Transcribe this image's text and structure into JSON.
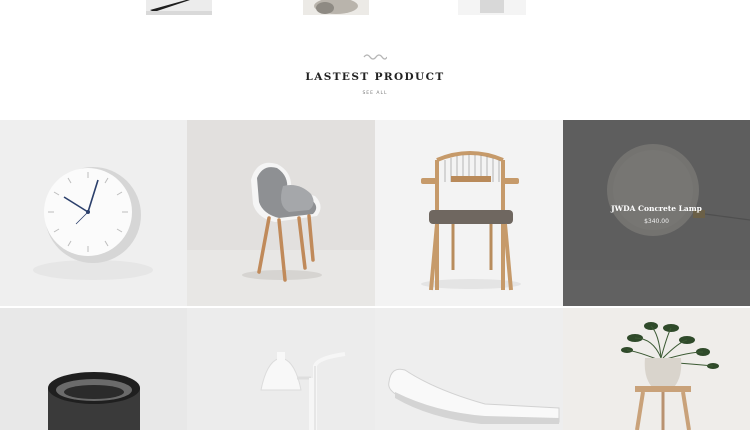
{
  "section": {
    "title": "LASTEST PRODUCT",
    "see_all": "SEE ALL"
  },
  "featured_product": {
    "name": "JWDA Concrete Lamp",
    "price": "$340.00"
  },
  "colors": {
    "title": "#222222",
    "overlay": "#464646",
    "tile_bg": [
      "#efefef",
      "#e2e0de",
      "#f3f3f3",
      "#9a9a9a",
      "#e8e8e8",
      "#ececec",
      "#eeeeee",
      "#efedea"
    ]
  },
  "products": [
    {
      "icon": "wall-clock-icon"
    },
    {
      "icon": "grey-armchair-icon"
    },
    {
      "icon": "wooden-chair-icon"
    },
    {
      "icon": "concrete-lamp-icon"
    },
    {
      "icon": "black-bowl-icon"
    },
    {
      "icon": "floor-lamp-icon"
    },
    {
      "icon": "white-lounge-chair-icon"
    },
    {
      "icon": "potted-plant-icon"
    }
  ]
}
